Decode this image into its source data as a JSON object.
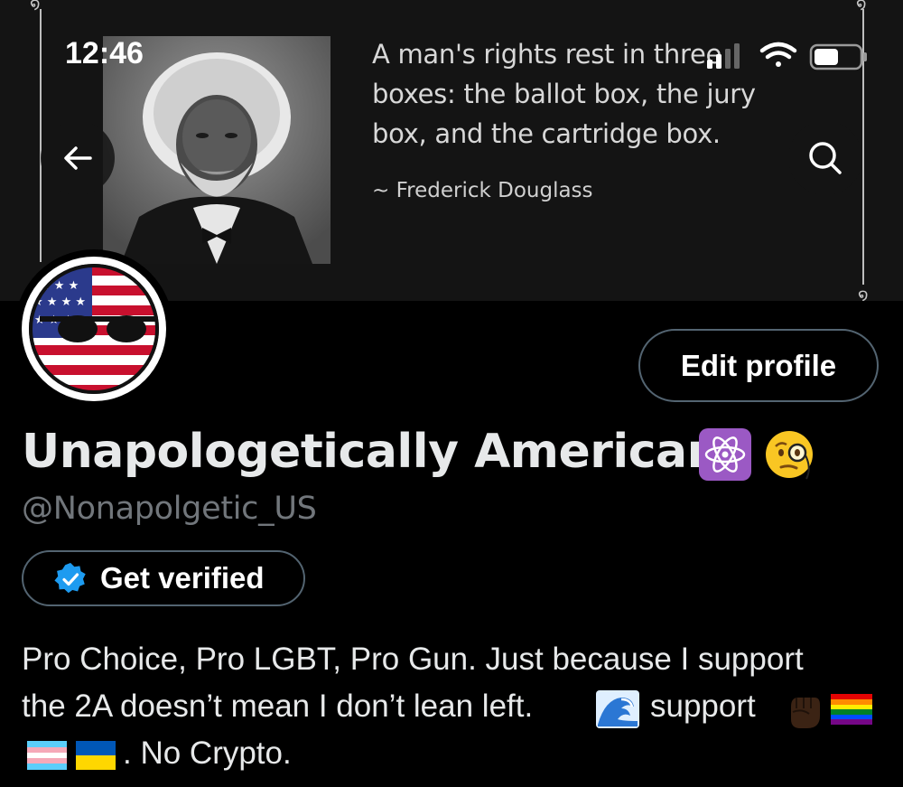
{
  "status_bar": {
    "time": "12:46",
    "icons": [
      "signal-icon",
      "wifi-icon",
      "battery-icon"
    ]
  },
  "banner": {
    "quote": "A man's rights rest in three boxes: the ballot box, the jury box, and the cartridge box.",
    "quote_lines": [
      "A man's rights rest in three",
      "boxes: the ballot box, the jury",
      "box, and the cartridge box."
    ],
    "author": "~ Frederick Douglass",
    "portrait": "portrait-photo"
  },
  "header": {
    "back_icon": "arrow-left-icon",
    "search_icon": "search-icon"
  },
  "profile": {
    "avatar": "usa-countryball-sunglasses",
    "edit_label": "Edit profile",
    "display_name": "Unapologetically American",
    "name_emojis": [
      "atom-emoji",
      "monocle-face-emoji"
    ],
    "handle": "@Nonapolgetic_US",
    "verify_label": "Get verified",
    "bio_lines": [
      "Pro Choice, Pro LGBT, Pro Gun. Just because I support",
      "the 2A doesn’t mean I don’t lean left.",
      "support",
      ". No Crypto."
    ],
    "bio_emojis": [
      "water-wave-emoji",
      "raised-fist-emoji",
      "rainbow-flag-emoji",
      "transgender-flag-emoji",
      "ukraine-flag-emoji"
    ]
  },
  "colors": {
    "background": "#000000",
    "banner_bg": "#141414",
    "text_primary": "#e7e9ea",
    "text_secondary": "#71767b",
    "border": "#536471",
    "verified_blue": "#1d9bf0"
  }
}
